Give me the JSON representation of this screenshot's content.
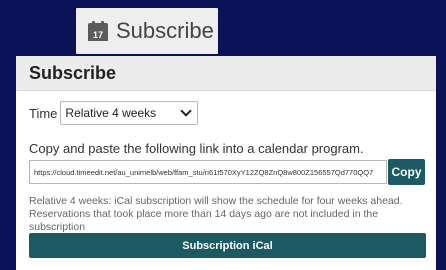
{
  "trigger": {
    "icon": "calendar-icon",
    "calendar_day": "17",
    "label": "Subscribe"
  },
  "dialog": {
    "title": "Subscribe",
    "time_label": "Time",
    "time_selected": "Relative 4 weeks",
    "instruction": "Copy and paste the following link into a calendar program.",
    "link_value": "https://cloud.timeedit.net/au_unimelb/web/ffam_stu/ri61t570XyY12ZQ8ZnQ8w800Z156557Qd770QQ7",
    "copy_label": "Copy",
    "note_line1": "Relative 4 weeks: iCal subscription will show the schedule for four weeks ahead.",
    "note_line2": "Reservations that took place more than 14 days ago are not included in the subscription",
    "ical_label": "Subscription iCal"
  },
  "colors": {
    "background": "#0b1258",
    "accent": "#1c5a63"
  }
}
